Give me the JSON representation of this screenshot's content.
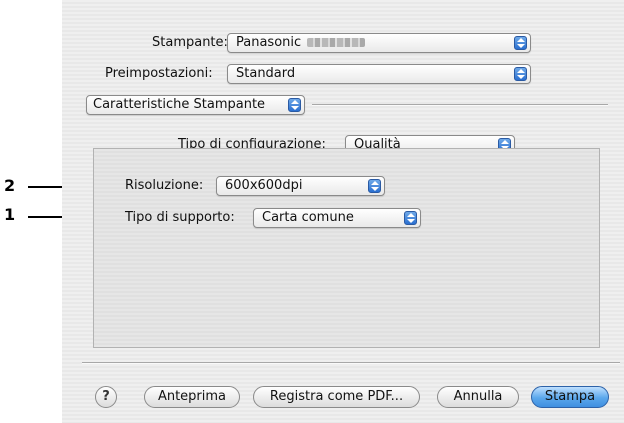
{
  "form": {
    "printer_label": "Stampante:",
    "printer_value": "Panasonic",
    "presets_label": "Preimpostazioni:",
    "presets_value": "Standard",
    "section_value": "Caratteristiche Stampante",
    "config_label": "Tipo di configurazione:",
    "config_value": "Qualità",
    "resolution_label": "Risoluzione:",
    "resolution_value": "600x600dpi",
    "media_label": "Tipo di supporto:",
    "media_value": "Carta comune"
  },
  "buttons": {
    "help": "?",
    "preview": "Anteprima",
    "save_pdf": "Registra come PDF...",
    "cancel": "Annulla",
    "print": "Stampa"
  },
  "callouts": [
    "2",
    "1"
  ],
  "colors": {
    "default_button": "#4f9ae6",
    "popup_arrow": "#2a6fd0"
  },
  "icons": {
    "popup_arrow": "up-down-arrows-icon",
    "help": "help-icon"
  }
}
